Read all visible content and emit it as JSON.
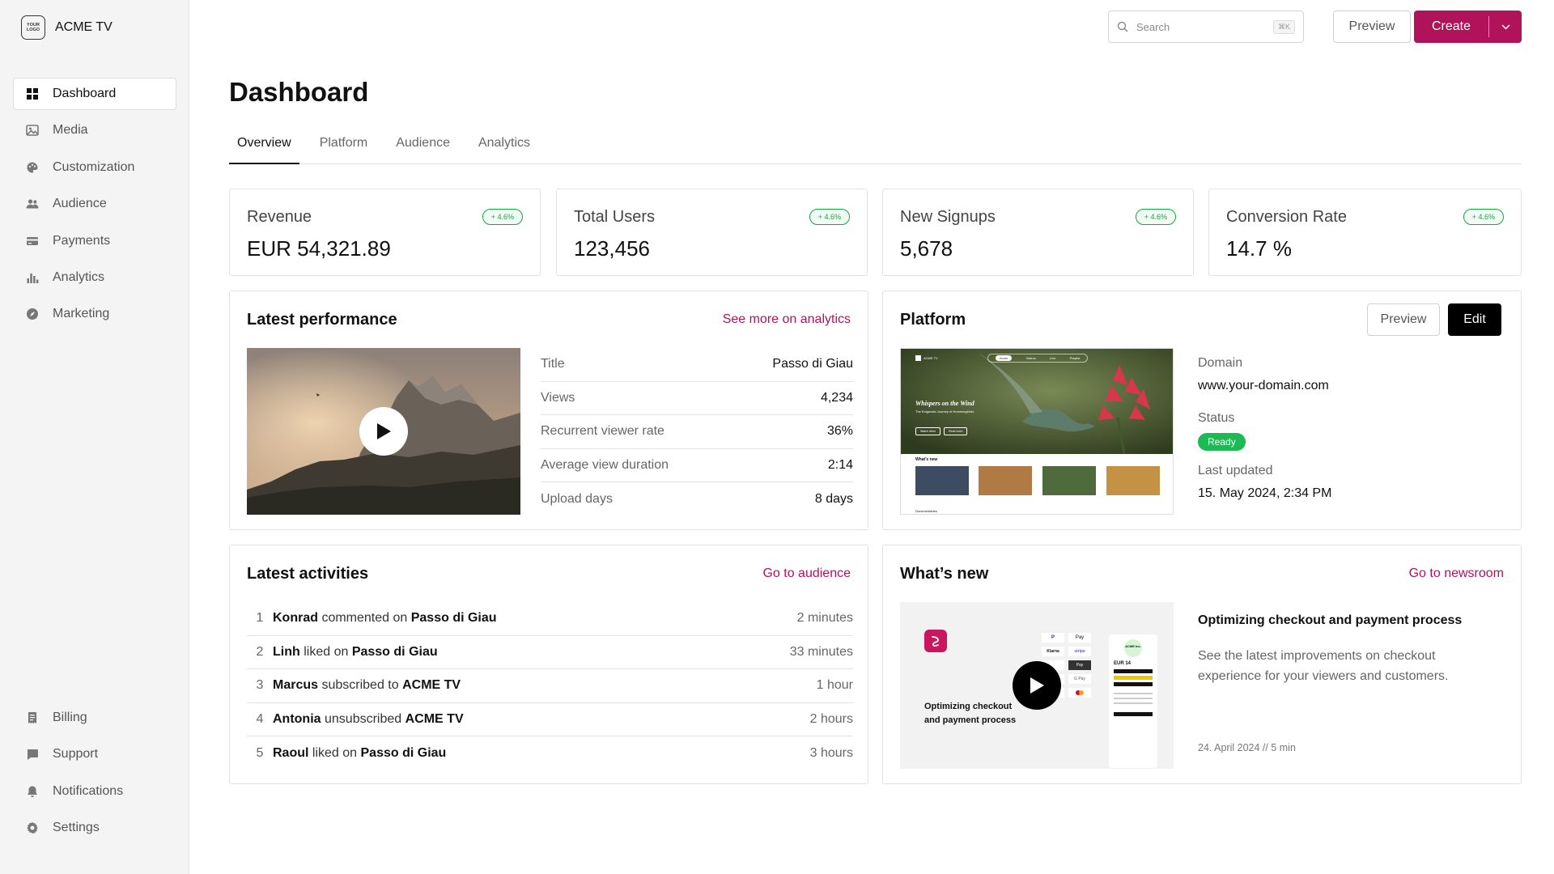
{
  "brand": {
    "logo_line1": "YOUR",
    "logo_line2": "LOGO",
    "name": "ACME TV"
  },
  "nav": {
    "main": [
      {
        "label": "Dashboard",
        "icon": "grid-icon"
      },
      {
        "label": "Media",
        "icon": "image-icon"
      },
      {
        "label": "Customization",
        "icon": "palette-icon"
      },
      {
        "label": "Audience",
        "icon": "users-icon"
      },
      {
        "label": "Payments",
        "icon": "credit-card-icon"
      },
      {
        "label": "Analytics",
        "icon": "bar-chart-icon"
      },
      {
        "label": "Marketing",
        "icon": "compass-icon"
      }
    ],
    "bottom": [
      {
        "label": "Billing",
        "icon": "receipt-icon"
      },
      {
        "label": "Support",
        "icon": "chat-icon"
      },
      {
        "label": "Notifications",
        "icon": "bell-icon"
      },
      {
        "label": "Settings",
        "icon": "gear-icon"
      }
    ]
  },
  "topbar": {
    "search_placeholder": "Search",
    "search_shortcut": "⌘K",
    "preview_label": "Preview",
    "create_label": "Create"
  },
  "page": {
    "title": "Dashboard"
  },
  "tabs": [
    "Overview",
    "Platform",
    "Audience",
    "Analytics"
  ],
  "stats": [
    {
      "label": "Revenue",
      "value": "EUR 54,321.89",
      "change": "+ 4.6%"
    },
    {
      "label": "Total Users",
      "value": "123,456",
      "change": "+ 4.6%"
    },
    {
      "label": "New Signups",
      "value": "5,678",
      "change": "+ 4.6%"
    },
    {
      "label": "Conversion Rate",
      "value": "14.7 %",
      "change": "+ 4.6%"
    }
  ],
  "performance": {
    "title": "Latest performance",
    "link": "See more on analytics",
    "rows": [
      {
        "k": "Title",
        "v": "Passo di Giau"
      },
      {
        "k": "Views",
        "v": "4,234"
      },
      {
        "k": "Recurrent viewer rate",
        "v": "36%"
      },
      {
        "k": "Average view duration",
        "v": "2:14"
      },
      {
        "k": "Upload days",
        "v": "8 days"
      }
    ]
  },
  "platform": {
    "title": "Platform",
    "preview_label": "Preview",
    "edit_label": "Edit",
    "domain_label": "Domain",
    "domain": "www.your-domain.com",
    "status_label": "Status",
    "status": "Ready",
    "updated_label": "Last updated",
    "updated": "15. May 2024, 2:34 PM",
    "preview": {
      "brand": "ACME TV",
      "nav": [
        "Home",
        "Videos",
        "Live",
        "Playlist"
      ],
      "hero_title": "Whispers on the Wind",
      "hero_sub": "The Enigmatic Journey of Hummingbirds",
      "btn1": "Watch video",
      "btn2": "Read more",
      "section": "What's new",
      "footer": "Documentaries"
    }
  },
  "activities": {
    "title": "Latest activities",
    "link": "Go to audience",
    "rows": [
      {
        "n": "1",
        "user": "Konrad",
        "action": " commented on ",
        "target": "Passo di Giau",
        "time": "2 minutes"
      },
      {
        "n": "2",
        "user": "Linh",
        "action": " liked on ",
        "target": "Passo di Giau",
        "time": "33 minutes"
      },
      {
        "n": "3",
        "user": "Marcus",
        "action": " subscribed to ",
        "target": "ACME TV",
        "time": "1 hour"
      },
      {
        "n": "4",
        "user": "Antonia",
        "action": " unsubscribed ",
        "target": "ACME TV",
        "time": "2 hours"
      },
      {
        "n": "5",
        "user": "Raoul",
        "action": " liked on ",
        "target": "Passo di Giau",
        "time": "3 hours"
      }
    ]
  },
  "news": {
    "title": "What’s new",
    "link": "Go to newsroom",
    "thumb_caption_1": "Optimizing checkout",
    "thumb_caption_2": "and payment process",
    "thumb_price": "EUR 14",
    "thumb_company": "ACME Inc.",
    "pay_labels": [
      "P",
      "Pay",
      "Klarna",
      "stripe",
      "Pay",
      "G Pay"
    ],
    "item_title": "Optimizing checkout and payment process",
    "item_desc": "See the latest improvements on checkout experience for your viewers and customers.",
    "item_meta": "24. April 2024 // 5 min"
  },
  "colors": {
    "accent": "#b0135a",
    "success": "#1db954",
    "badge": "#19a544"
  }
}
